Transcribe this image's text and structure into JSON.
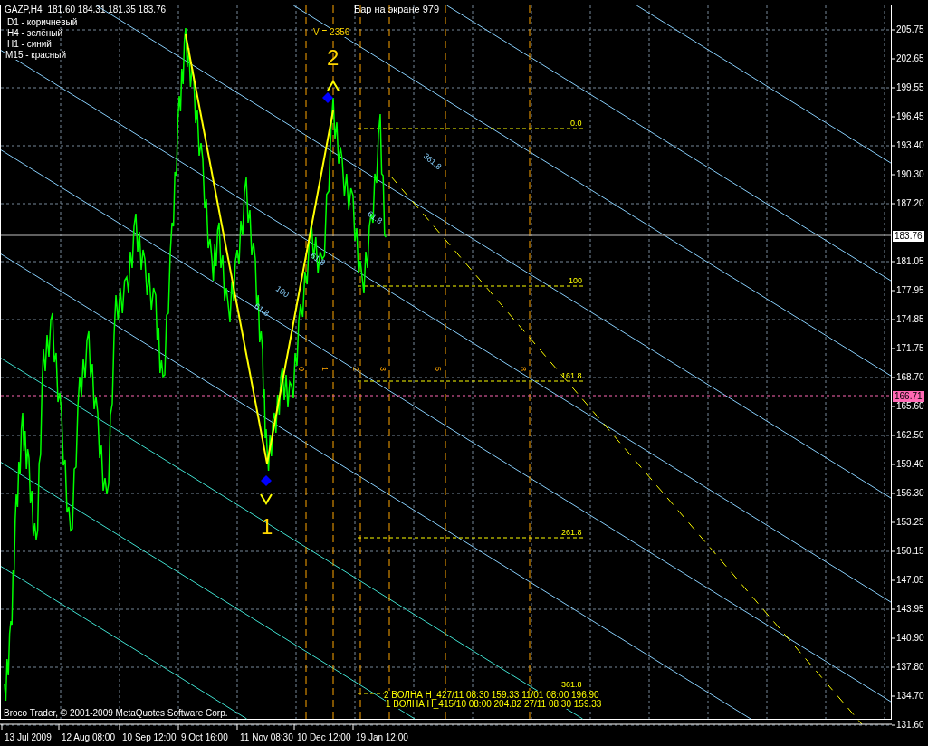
{
  "header": {
    "symbol": "GAZP,H4",
    "ohlc": "181.60 184.31 181.35 183.76"
  },
  "legend": [
    "D1 - коричневый",
    "H4 - зелёный",
    "H1 - синий",
    "M15 - красный"
  ],
  "bars_on_screen": "Бар на экране 979",
  "volume_label": "V = 2356",
  "wave_numbers": [
    "2",
    "1"
  ],
  "fib_labels": [
    "0.0",
    "100",
    "161.8",
    "261.8",
    "361.8"
  ],
  "channel_labels": [
    "361.8",
    "100",
    "61.8",
    "61.8",
    "61.8"
  ],
  "time_markers": [
    "0",
    "1",
    "2",
    "3",
    "5",
    "8"
  ],
  "wave_info": [
    "2 ВОЛНА Н_427/11 08:30 159.33 11/01 08:00 196.90",
    "1 ВОЛНА Н_415/10 08:00 204.82 27/11 08:30 159.33"
  ],
  "copyright": "Broco Trader, © 2001-2009 MetaQuotes Software Corp.",
  "price_axis": [
    "205.75",
    "202.65",
    "199.55",
    "196.45",
    "193.40",
    "190.30",
    "187.20",
    "181.05",
    "177.95",
    "174.85",
    "171.75",
    "168.70",
    "165.60",
    "162.50",
    "159.40",
    "156.30",
    "153.25",
    "150.15",
    "147.05",
    "143.95",
    "140.90",
    "137.80",
    "134.70",
    "131.60"
  ],
  "price_markers": [
    {
      "kind": "bid",
      "text": "183.76"
    },
    {
      "kind": "line",
      "text": "166.71"
    }
  ],
  "time_axis": [
    "13 Jul 2009",
    "12 Aug 08:00",
    "10 Sep 12:00",
    "9 Oct 16:00",
    "11 Nov 08:30",
    "10 Dec 12:00",
    "19 Jan 12:00"
  ]
}
